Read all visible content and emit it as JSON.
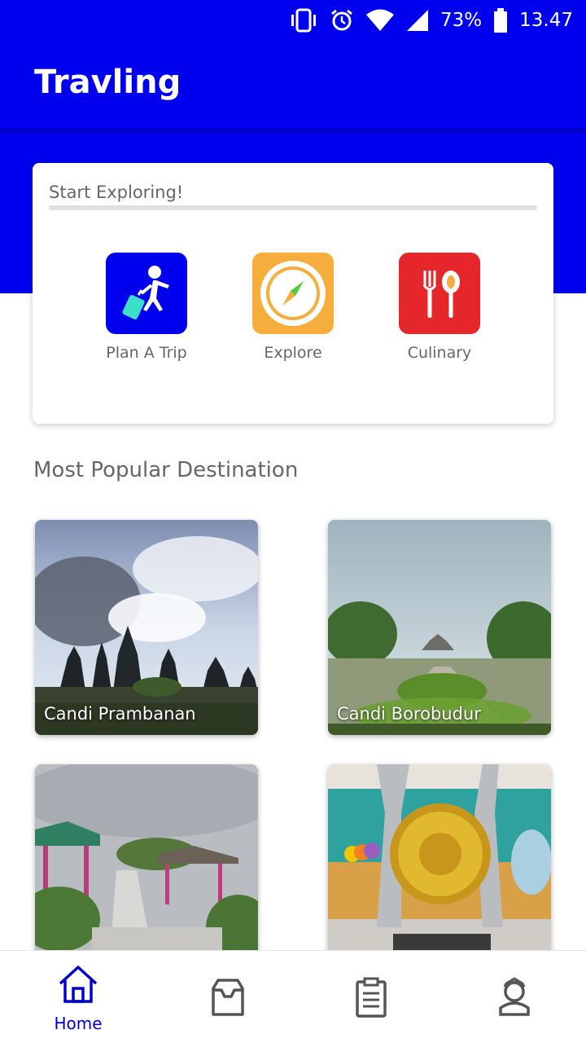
{
  "status_bar": {
    "battery": "73%",
    "time": "13.47"
  },
  "app": {
    "title": "Travling"
  },
  "explore_card": {
    "title": "Start Exploring!",
    "items": [
      {
        "label": "Plan A Trip",
        "icon": "traveler-luggage-icon",
        "color": "#0000ee"
      },
      {
        "label": "Explore",
        "icon": "compass-icon",
        "color": "#f6ad3c"
      },
      {
        "label": "Culinary",
        "icon": "fork-spoon-icon",
        "color": "#e5262a"
      }
    ]
  },
  "popular": {
    "title": "Most Popular Destination",
    "destinations": [
      {
        "label": "Candi Prambanan"
      },
      {
        "label": "Candi Borobudur"
      },
      {
        "label": ""
      },
      {
        "label": ""
      }
    ]
  },
  "bottom_nav": {
    "active_color": "#0000cc",
    "items": [
      {
        "label": "Home",
        "icon": "home-icon"
      },
      {
        "label": "",
        "icon": "inbox-icon"
      },
      {
        "label": "",
        "icon": "clipboard-icon"
      },
      {
        "label": "",
        "icon": "profile-icon"
      }
    ]
  }
}
